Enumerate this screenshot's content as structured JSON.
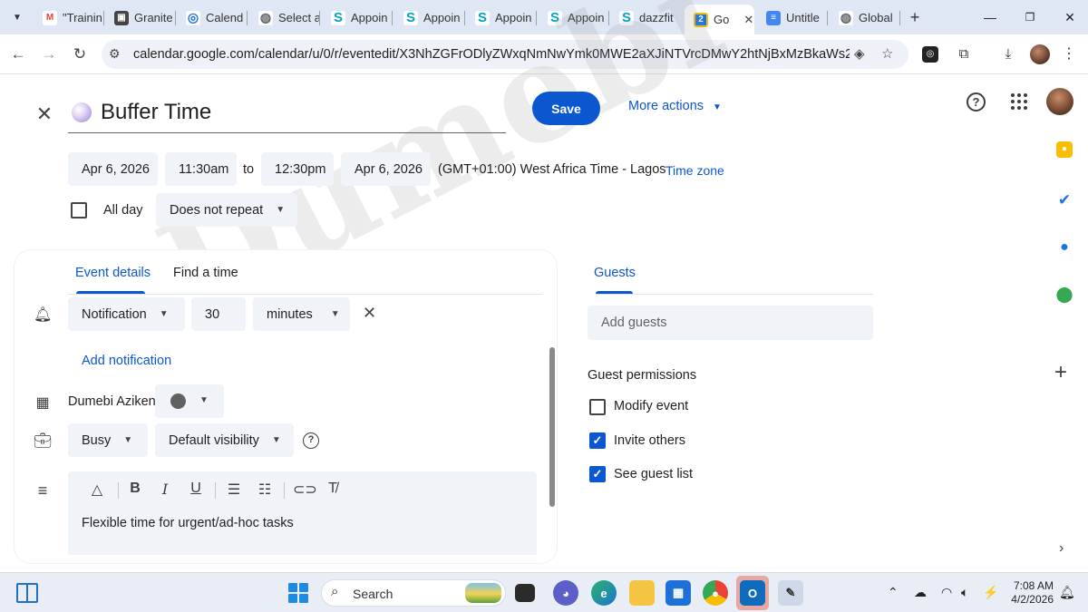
{
  "browser": {
    "tabs": [
      {
        "title": "\"Trainin",
        "icon": "gmail-icon",
        "color": "#ea4335",
        "glyph": "M"
      },
      {
        "title": "Granite",
        "icon": "image-icon",
        "color": "#444444",
        "glyph": "▣"
      },
      {
        "title": "Calend",
        "icon": "circle-icon",
        "color": "#1a73e8",
        "glyph": "◎"
      },
      {
        "title": "Select a",
        "icon": "globe-icon",
        "color": "#5f6368",
        "glyph": "◍"
      },
      {
        "title": "Appoin",
        "icon": "s-icon",
        "color": "#00a2c7",
        "glyph": "S"
      },
      {
        "title": "Appoin",
        "icon": "s-icon",
        "color": "#00a2c7",
        "glyph": "S"
      },
      {
        "title": "Appoin",
        "icon": "s-icon",
        "color": "#00a2c7",
        "glyph": "S"
      },
      {
        "title": "Appoin",
        "icon": "s-icon",
        "color": "#00a2c7",
        "glyph": "S"
      },
      {
        "title": "dazzfit",
        "icon": "s-icon",
        "color": "#00a2c7",
        "glyph": "S"
      },
      {
        "title": "Go",
        "icon": "calendar-icon",
        "color": "#1a73e8",
        "glyph": "2",
        "active": true
      },
      {
        "title": "Untitle",
        "icon": "docs-icon",
        "color": "#4285f4",
        "glyph": "≡"
      },
      {
        "title": "Global",
        "icon": "globe-icon",
        "color": "#5f6368",
        "glyph": "◍"
      }
    ],
    "url_host": "calendar.google.com",
    "url_path": "/calendar/u/0/r/eventedit/X3NhZGFrODlyZWxqNmNwYmk0MWE2aXJiNTVrcDMwY2htNjBxMzBkaWs2NG9qNm..."
  },
  "event": {
    "title": "Buffer Time",
    "save_label": "Save",
    "more_actions_label": "More actions",
    "start_date": "Apr 6, 2026",
    "start_time": "11:30am",
    "to_label": "to",
    "end_time": "12:30pm",
    "end_date": "Apr 6, 2026",
    "timezone_text": "(GMT+01:00) West Africa Time - Lagos",
    "timezone_link": "Time zone",
    "all_day_label": "All day",
    "repeat_value": "Does not repeat"
  },
  "details": {
    "tab_event_details": "Event details",
    "tab_find_time": "Find a time",
    "notification_type": "Notification",
    "notification_amount": "30",
    "notification_unit": "minutes",
    "add_notification": "Add notification",
    "owner": "Dumebi Aziken",
    "busy_value": "Busy",
    "visibility_value": "Default visibility",
    "description": "Flexible time for urgent/ad-hoc tasks"
  },
  "guests": {
    "tab_label": "Guests",
    "add_placeholder": "Add guests",
    "permissions_title": "Guest permissions",
    "permissions": [
      {
        "label": "Modify event",
        "checked": false
      },
      {
        "label": "Invite others",
        "checked": true
      },
      {
        "label": "See guest list",
        "checked": true
      }
    ]
  },
  "watermark": "Dumebi",
  "taskbar": {
    "search_label": "Search",
    "time": "7:08 AM",
    "date": "4/2/2026"
  },
  "colors": {
    "accent": "#0b57d0",
    "chip_bg": "#f0f4f9",
    "tabbar_bg": "#dfe7f5"
  }
}
